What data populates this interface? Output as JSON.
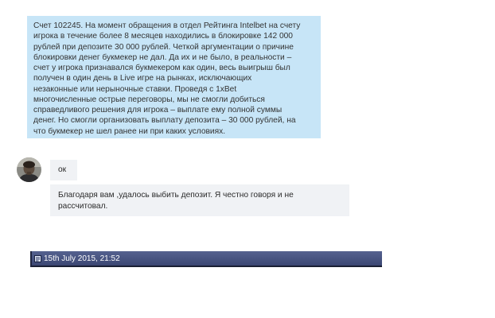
{
  "notice": {
    "text": "Счет 102245. На момент обращения в отдел Рейтинга Intelbet на счету\nигрока в течение более 8 месяцев находились в блокировке 142 000\nрублей при депозите 30 000 рублей. Четкой аргументации о причине\nблокировки денег букмекер не дал. Да их и не было, в реальности –\nсчет у игрока признавался букмекером как один, весь выигрыш был\nполучен в один день в Live игре на рынках, исключающих\nнезаконные или нерыночные ставки.  Проведя с 1xBet\nмногочисленные острые переговоры,  мы не смогли добиться\nсправедливого решения для игрока – выплате ему полной суммы\nденег. Но смогли организовать выплату депозита – 30 000 рублей, на\nчто букмекер не шел ранее ни при каких условиях."
  },
  "chat": {
    "avatar_icon": "user-avatar-photo",
    "message_1": "ок",
    "message_2": "Благодаря вам ,удалось выбить депозит. Я честно говоря и не\nрассчитовал."
  },
  "post_bar": {
    "icon": "post-document-icon",
    "date": "15th July 2015, 21:52",
    "colors": {
      "bar": "#46527f",
      "text": "#ffffff"
    }
  },
  "colors": {
    "notice_bg": "#c7e5f7",
    "bubble_bg": "#f0f2f5"
  }
}
